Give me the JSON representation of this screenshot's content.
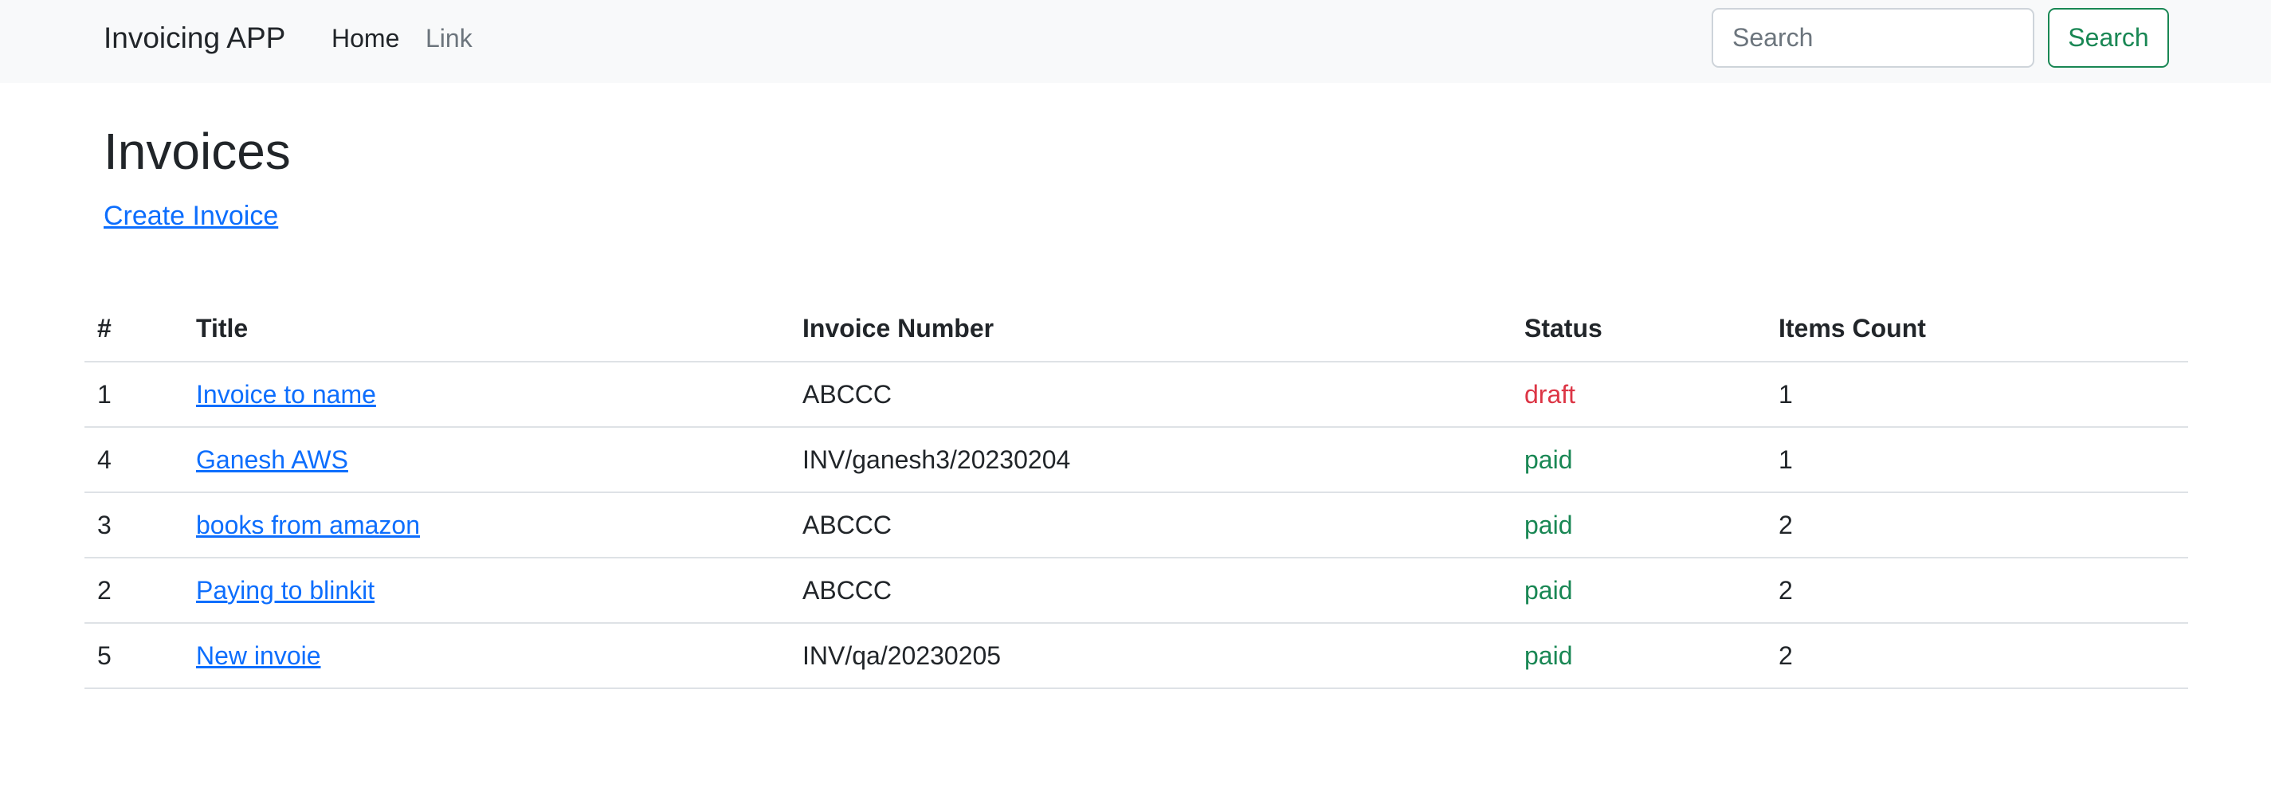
{
  "navbar": {
    "brand": "Invoicing APP",
    "links": [
      {
        "label": "Home"
      },
      {
        "label": "Link"
      }
    ],
    "search": {
      "placeholder": "Search",
      "value": "",
      "button_label": "Search"
    }
  },
  "main": {
    "title": "Invoices",
    "create_link": "Create Invoice",
    "table": {
      "columns": [
        "#",
        "Title",
        "Invoice Number",
        "Status",
        "Items Count"
      ],
      "rows": [
        {
          "id": "1",
          "title": "Invoice to name",
          "invoice_number": "ABCCC",
          "status": "draft",
          "items_count": "1"
        },
        {
          "id": "4",
          "title": "Ganesh AWS",
          "invoice_number": "INV/ganesh3/20230204",
          "status": "paid",
          "items_count": "1"
        },
        {
          "id": "3",
          "title": "books from amazon",
          "invoice_number": "ABCCC",
          "status": "paid",
          "items_count": "2"
        },
        {
          "id": "2",
          "title": "Paying to blinkit",
          "invoice_number": "ABCCC",
          "status": "paid",
          "items_count": "2"
        },
        {
          "id": "5",
          "title": "New invoie",
          "invoice_number": "INV/qa/20230205",
          "status": "paid",
          "items_count": "2"
        }
      ]
    }
  },
  "colors": {
    "link": "#0d6efd",
    "status_draft": "#dc3545",
    "status_paid": "#198754",
    "navbar_bg": "#f8f9fa"
  }
}
